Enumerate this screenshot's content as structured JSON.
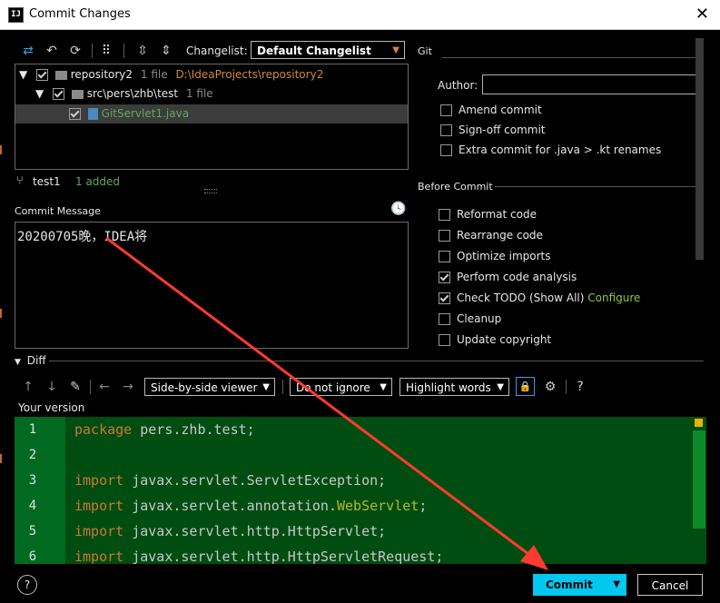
{
  "window": {
    "title": "Commit Changes",
    "app_icon": "IJ"
  },
  "toolbar": {
    "changelist_label": "Changelist:",
    "changelist_value": "Default Changelist"
  },
  "tree": {
    "root": {
      "name": "repository2",
      "count": "1 file",
      "path": "D:\\IdeaProjects\\repository2"
    },
    "folder": {
      "name": "src\\pers\\zhb\\test",
      "count": "1 file"
    },
    "file": {
      "name": "GitServlet1.java"
    }
  },
  "branch": {
    "name": "test1",
    "status": "1 added"
  },
  "commit_message": {
    "label": "Commit Message",
    "text": "20200705晚，IDEA将"
  },
  "git": {
    "section": "Git",
    "author_label": "Author:",
    "author_value": "",
    "options": [
      "Amend commit",
      "Sign-off commit",
      "Extra commit for .java > .kt renames"
    ]
  },
  "before_commit": {
    "section": "Before Commit",
    "options": [
      {
        "label": "Reformat code",
        "checked": false
      },
      {
        "label": "Rearrange code",
        "checked": false
      },
      {
        "label": "Optimize imports",
        "checked": false
      },
      {
        "label": "Perform code analysis",
        "checked": true
      },
      {
        "label": "Check TODO (Show All)",
        "checked": true,
        "link": "Configure"
      },
      {
        "label": "Cleanup",
        "checked": false
      },
      {
        "label": "Update copyright",
        "checked": false
      }
    ]
  },
  "diff": {
    "section": "Diff",
    "viewer": "Side-by-side viewer",
    "whitespace": "Do not ignore",
    "highlight": "Highlight words",
    "your_version": "Your version",
    "line_numbers": [
      "1",
      "2",
      "3",
      "4",
      "5",
      "6"
    ],
    "lines": [
      {
        "kw": "package",
        "rest": " pers.zhb.test;",
        "ann": ""
      },
      {
        "kw": "",
        "rest": "",
        "ann": ""
      },
      {
        "kw": "import",
        "rest": " javax.servlet.ServletException;",
        "ann": ""
      },
      {
        "kw": "import",
        "rest": " javax.servlet.annotation.",
        "ann": "WebServlet",
        "tail": ";"
      },
      {
        "kw": "import",
        "rest": " javax.servlet.http.HttpServlet;",
        "ann": ""
      },
      {
        "kw": "import",
        "rest": " javax.servlet.http.HttpServletRequest;",
        "ann": ""
      }
    ]
  },
  "footer": {
    "help": "?",
    "commit": "Commit",
    "cancel": "Cancel"
  },
  "colors": {
    "accent": "#00c8f0",
    "annotation_arrow": "#ff3b30",
    "diff_added": "#004d12"
  }
}
